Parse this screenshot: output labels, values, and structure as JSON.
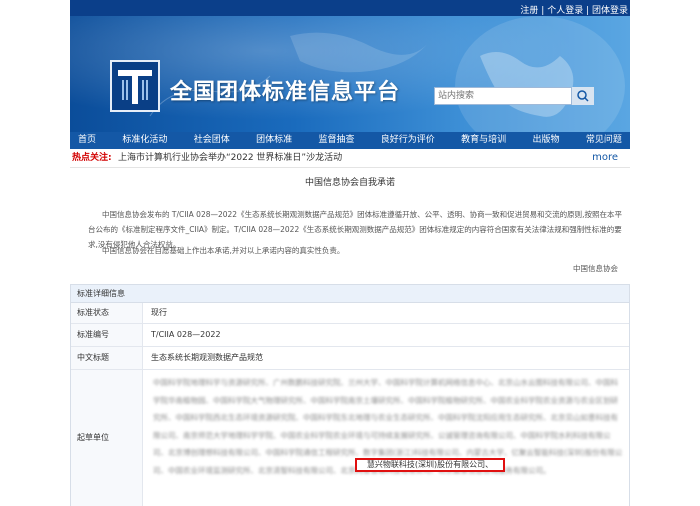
{
  "header": {
    "links": [
      "注册",
      "个人登录",
      "团体登录"
    ],
    "site_title": "全国团体标准信息平台",
    "search_placeholder": "站内搜索"
  },
  "nav": [
    "首页",
    "标准化活动",
    "社会团体",
    "团体标准",
    "监督抽查",
    "良好行为评价",
    "教育与培训",
    "出版物",
    "常见问题"
  ],
  "hot": {
    "label": "热点关注:",
    "text": "上海市计算机行业协会举办“2022 世界标准日”沙龙活动",
    "more": "more"
  },
  "notice": {
    "title": "中国信息协会自我承诺",
    "para1": "中国信息协会发布的 T/CIIA 028—2022《生态系统长期观测数据产品规范》团体标准遵循开放、公平、透明、协商一致和促进贸易和交流的原则,按照在本平台公布的《标准制定程序文件_CIIA》制定。T/CIIA 028—2022《生态系统长期观测数据产品规范》团体标准规定的内容符合国家有关法律法规和强制性标准的要求,没有侵犯他人合法权益。",
    "para2": "中国信息协会在自愿基础上作出本承诺,并对以上承诺内容的真实性负责。",
    "signature": "中国信息协会"
  },
  "table": {
    "header": "标准详细信息",
    "rows": [
      {
        "key": "标准状态",
        "value": "现行"
      },
      {
        "key": "标准编号",
        "value": "T/CIIA 028—2022"
      },
      {
        "key": "中文标题",
        "value": "生态系统长期观测数据产品规范"
      },
      {
        "key": "起草单位",
        "value": ""
      }
    ],
    "drafters_blurred": "中国科学院地理科学与资源研究所、广州数鹏科技研究院、兰州大学、中国科学院计算机网络信息中心、北京山水云图科技有限公司、中国科学院华南植物园、中国科学院大气物理研究所、中国科学院南京土壤研究所、中国科学院植物研究所、中国农业科学院农业资源与农业区划研究所、中国科学院西北生态环境资源研究院、中国科学院东北地理与农业生态研究所、中国科学院沈阳应用生态研究所、北京见山如意科技有限公司、南京师范大学地理科学学院、中国农业科学院农业环境与可持续发展研究所、公诚管理咨询有限公司、中国科学院水利科技有限公司、北京博创理想科技有限公司、中国科学院通信工程研究所、数字集团(浙江)科技有限公司、内蒙古大学、亿聚云智能科技(深圳)股份有限公司、",
    "drafter_highlight": "慧兴物联科技(深圳)股份有限公司、",
    "drafters_tail": "中国农业环境监测研究所、北京清智科技有限公司、北京网智普通科技有限公司、北京蓝象信息咨询服务有限公司。"
  }
}
